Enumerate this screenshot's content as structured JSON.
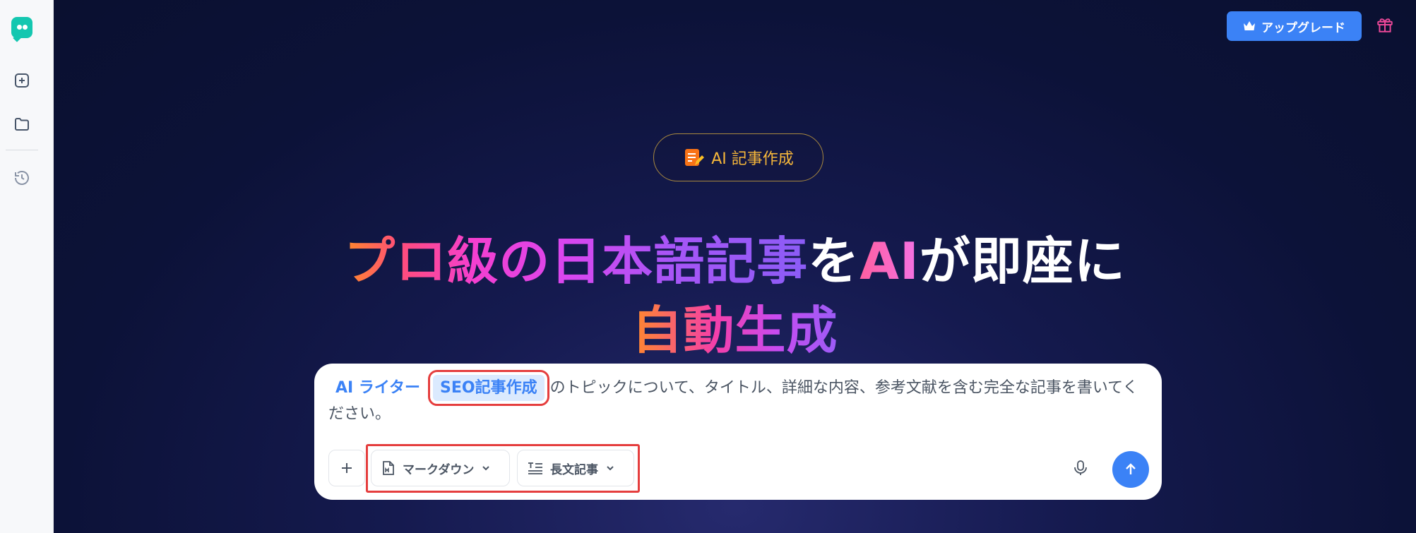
{
  "header": {
    "upgrade_label": "アップグレード"
  },
  "badge": {
    "label": "AI 記事作成"
  },
  "headline": {
    "line1_part1": "プロ級の日本語記事",
    "line1_part2": "を",
    "line1_part3": "AI",
    "line1_part4": "が即座に",
    "line2": "自動生成"
  },
  "composer": {
    "chip_primary": "AI ライター",
    "chip_selected": "SEO記事作成",
    "prompt_text": "のトピックについて、タイトル、詳細な内容、参考文献を含む完全な記事を書いてください。",
    "format_select": "マークダウン",
    "length_select": "長文記事"
  },
  "colors": {
    "accent": "#3b82f6",
    "badge_text": "#f6b73a",
    "highlight_border": "#e53e3e"
  }
}
